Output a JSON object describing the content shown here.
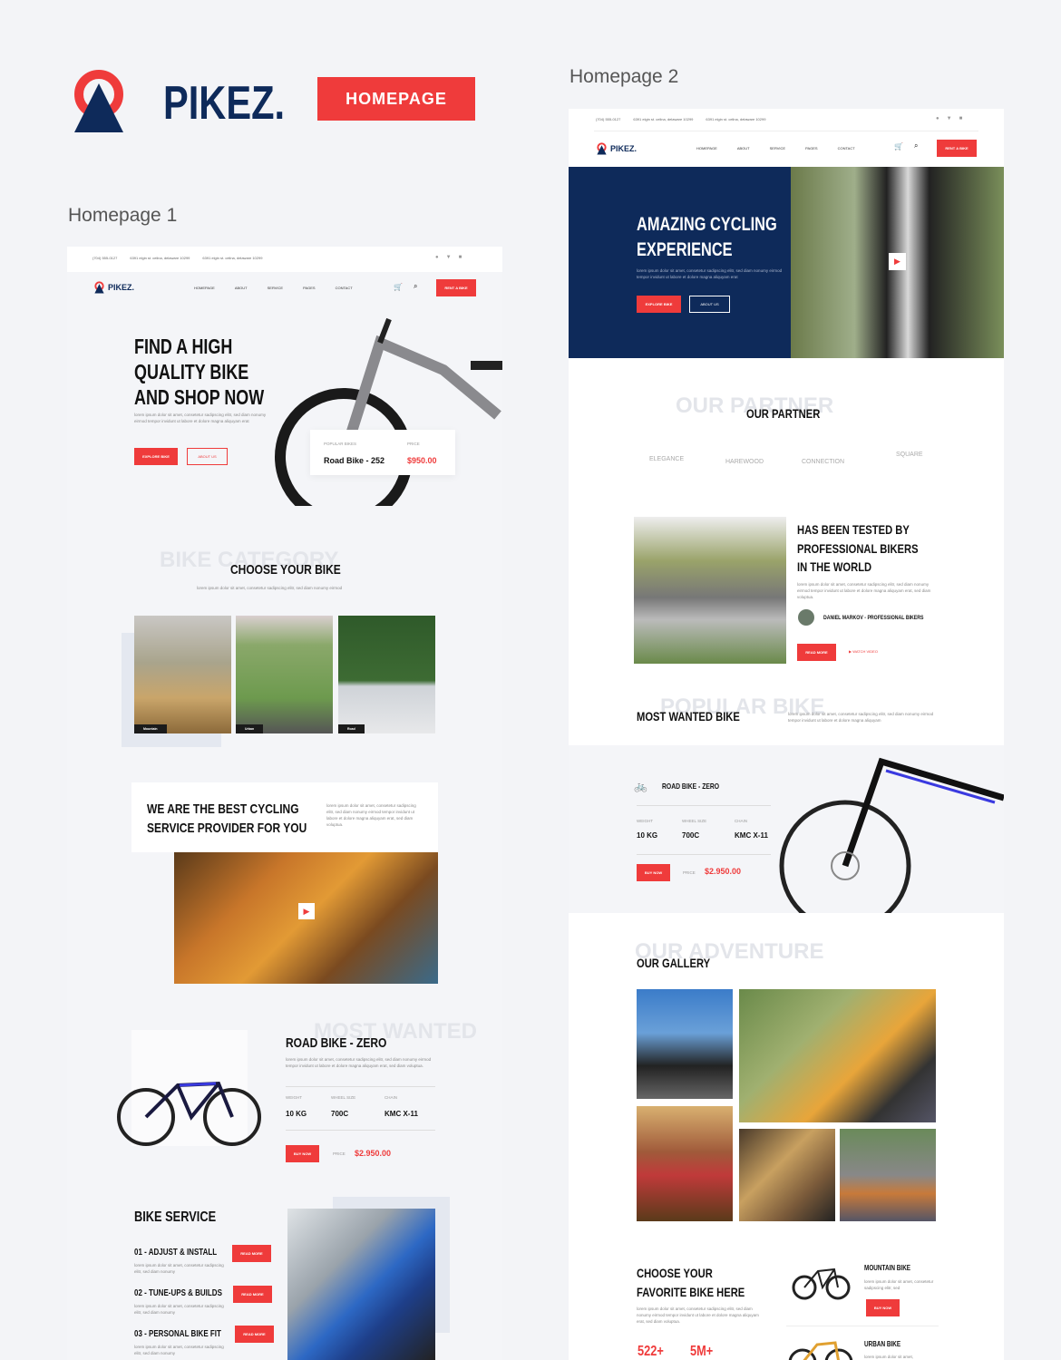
{
  "brand": {
    "name": "PIKEZ.",
    "badge": "HOMEPAGE",
    "accent": "#ef3b3b",
    "navy": "#0e2a5a"
  },
  "labels": {
    "hp1": "Homepage 1",
    "hp2": "Homepage 2"
  },
  "topbar": {
    "phone": "(704) 555-0127",
    "address": "6391 elgin st. celina, delaware 10299",
    "email": "6391 elgin st. celina, delaware 10299",
    "social": [
      "facebook-icon",
      "twitter-icon",
      "youtube-icon"
    ]
  },
  "nav": {
    "logo": "PIKEZ.",
    "items": [
      "HOMEPAGE",
      "ABOUT",
      "SERVICE",
      "PAGES",
      "CONTACT"
    ],
    "cta": "RENT A BIKE"
  },
  "hp1": {
    "hero": {
      "title_lines": [
        "FIND A HIGH",
        "QUALITY BIKE",
        "AND SHOP NOW"
      ],
      "text": "lorem ipsum dolor sit amet, consetetur sadipscing elitr, sed diam nonumy eirmod tempor invidunt ut labore et dolore magna aliquyam erat",
      "btn1": "EXPLORE BIKE",
      "btn2": "ABOUT US",
      "popular_label": "POPULAR BIKES",
      "popular_name": "Road Bike - 252",
      "price_label": "PRICE",
      "price": "$950.00"
    },
    "category": {
      "ghost": "BIKE CATEGORY",
      "title": "CHOOSE YOUR BIKE",
      "text": "lorem ipsum dolor sit amet, consetetur sadipscing elitr, sed diam nonumy eirmod",
      "items": [
        "Mountain",
        "Urban",
        "Road"
      ]
    },
    "service_provider": {
      "title_lines": [
        "WE ARE THE BEST CYCLING",
        "SERVICE PROVIDER FOR YOU"
      ],
      "text": "lorem ipsum dolor sit amet, consetetur sadipscing elitr, sed diam nonumy eirmod tempor invidunt ut labore et dolore magna aliquyam erat, sed diam voluptua."
    },
    "most_wanted": {
      "ghost": "MOST WANTED",
      "title": "ROAD BIKE - ZERO",
      "text": "lorem ipsum dolor sit amet, consetetur sadipscing elitr, sed diam nonumy eirmod tempor invidunt ut labore et dolore magna aliquyam erat, sed diam voluptua.",
      "specs": [
        {
          "label": "WEIGHT",
          "value": "10 KG"
        },
        {
          "label": "WHEEL SIZE",
          "value": "700C"
        },
        {
          "label": "CHAIN",
          "value": "KMC X-11"
        }
      ],
      "buy": "BUY NOW",
      "price_label": "PRICE",
      "price": "$2.950.00"
    },
    "service": {
      "title": "BIKE SERVICE",
      "items": [
        {
          "title": "01 - ADJUST & INSTALL",
          "text": "lorem ipsum dolor sit amet, consetetur sadipscing elitr, sed diam nonumy",
          "btn": "READ MORE"
        },
        {
          "title": "02 - TUNE-UPS & BUILDS",
          "text": "lorem ipsum dolor sit amet, consetetur sadipscing elitr, sed diam nonumy",
          "btn": "READ MORE"
        },
        {
          "title": "03 - PERSONAL BIKE FIT",
          "text": "lorem ipsum dolor sit amet, consetetur sadipscing elitr, sed diam nonumy",
          "btn": "READ MORE"
        }
      ]
    }
  },
  "hp2": {
    "hero": {
      "title_lines": [
        "AMAZING CYCLING",
        "EXPERIENCE"
      ],
      "text": "lorem ipsum dolor sit amet, consetetur sadipscing elitr, sed diam nonumy eirmod tempor invidunt ut labore et dolore magna aliquyam erat",
      "btn1": "EXPLORE BIKE",
      "btn2": "ABOUT US"
    },
    "partner": {
      "ghost": "OUR PARTNER",
      "title": "OUR PARTNER",
      "logos": [
        "ELEGANCE",
        "HAREWOOD",
        "CONNECTION",
        "SQUARE"
      ]
    },
    "tested": {
      "title_lines": [
        "HAS BEEN TESTED BY",
        "PROFESSIONAL BIKERS",
        "IN THE WORLD"
      ],
      "text": "lorem ipsum dolor sit amet, consetetur sadipscing elitr, sed diam nonumy eirmod tempor invidunt ut labore et dolore magna aliquyam erat, sed diam voluptua.",
      "author": "DANIEL MARKOV - PROFESSIONAL BIKERS",
      "btn": "READ MORE",
      "video": "WATCH VIDEO"
    },
    "popular": {
      "ghost": "POPULAR BIKE",
      "title": "MOST WANTED BIKE",
      "text": "lorem ipsum dolor sit amet, consetetur sadipscing elitr, sed diam nonumy eirmod tempor invidunt ut labore et dolore magna aliquyam"
    },
    "product": {
      "name": "ROAD BIKE - ZERO",
      "specs": [
        {
          "label": "WEIGHT",
          "value": "10 KG"
        },
        {
          "label": "WHEEL SIZE",
          "value": "700C"
        },
        {
          "label": "CHAIN",
          "value": "KMC X-11"
        }
      ],
      "buy": "BUY NOW",
      "price_label": "PRICE",
      "price": "$2.950.00"
    },
    "gallery": {
      "ghost": "OUR ADVENTURE",
      "title": "OUR GALLERY"
    },
    "choose": {
      "title_lines": [
        "CHOOSE YOUR",
        "FAVORITE BIKE HERE"
      ],
      "text": "lorem ipsum dolor sit amet, consetetur sadipscing elitr, sed diam nonumy eirmod tempor invidunt ut labore et dolore magna aliquyam erat, sed diam voluptua.",
      "stats": [
        "522+",
        "5M+"
      ],
      "bikes": [
        {
          "name": "MOUNTAIN BIKE",
          "text": "lorem ipsum dolor sit amet, consetetur sadipscing elitr, sed",
          "btn": "BUY NOW"
        },
        {
          "name": "URBAN BIKE",
          "text": "lorem ipsum dolor sit amet,"
        }
      ]
    }
  }
}
